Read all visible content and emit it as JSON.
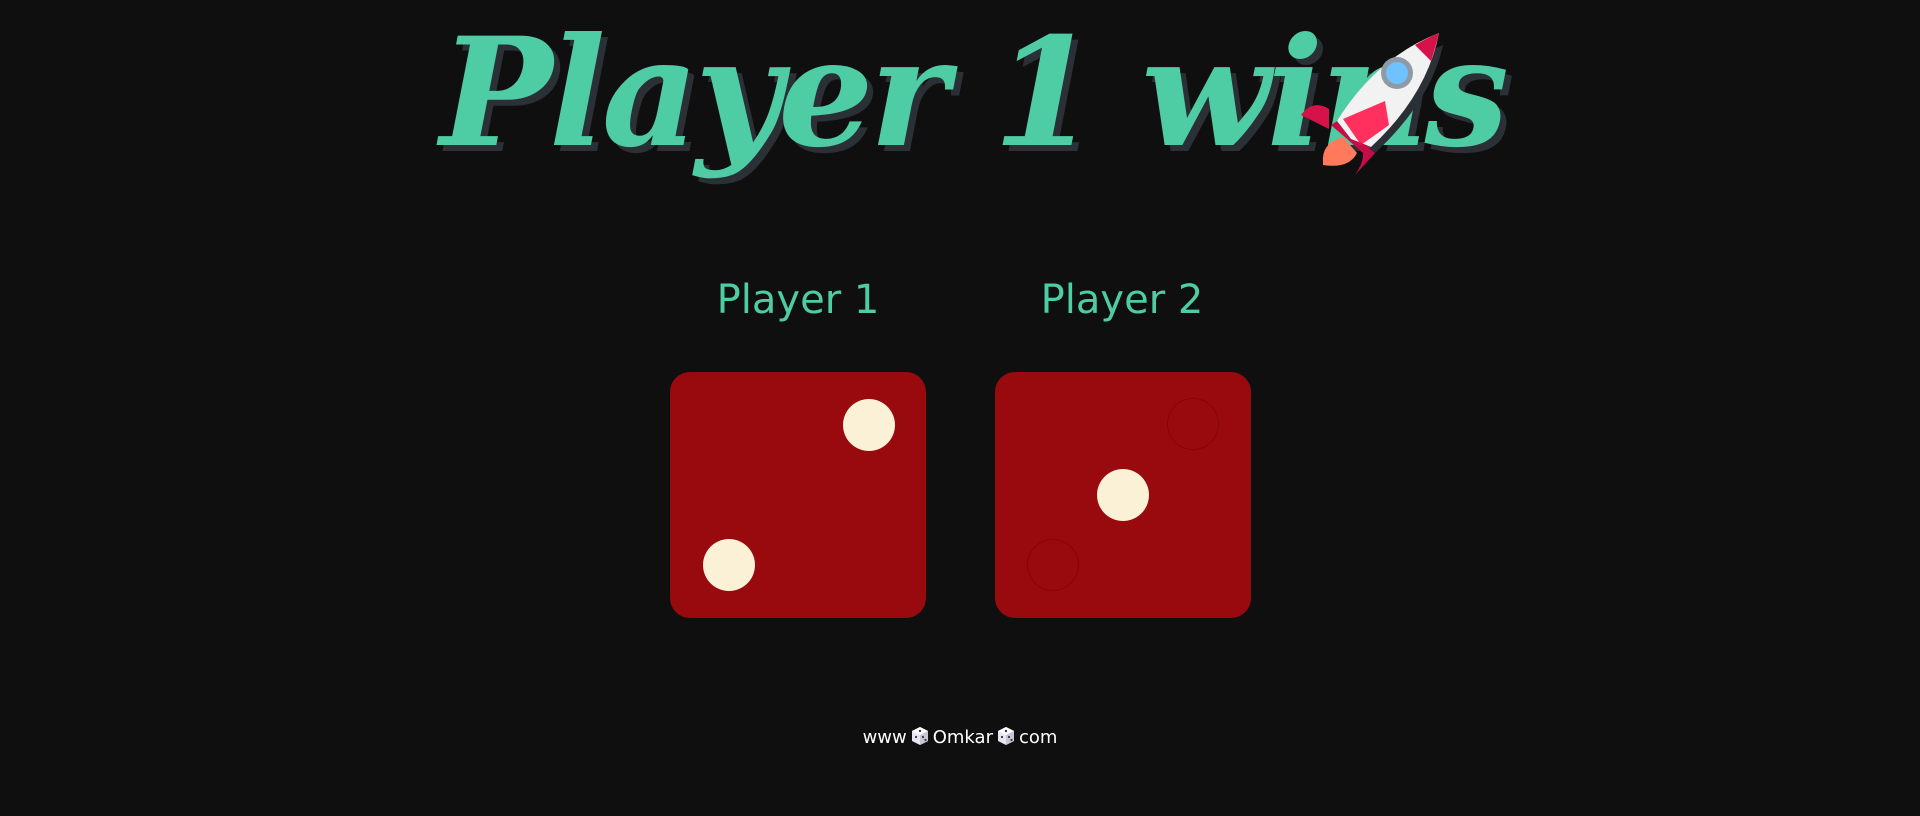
{
  "header": {
    "title": "Player 1 wins",
    "icon": "rocket-icon"
  },
  "players": [
    {
      "label": "Player 1",
      "die_value": 2
    },
    {
      "label": "Player 2",
      "die_value": 3
    }
  ],
  "colors": {
    "accent": "#4ecca3",
    "background": "#0f0f0f",
    "die": "#990a0e",
    "pip": "#fbf1d6"
  },
  "footer": {
    "prefix": "www",
    "name": "Omkar",
    "suffix": "com",
    "separator_icon": "dice-icon"
  }
}
